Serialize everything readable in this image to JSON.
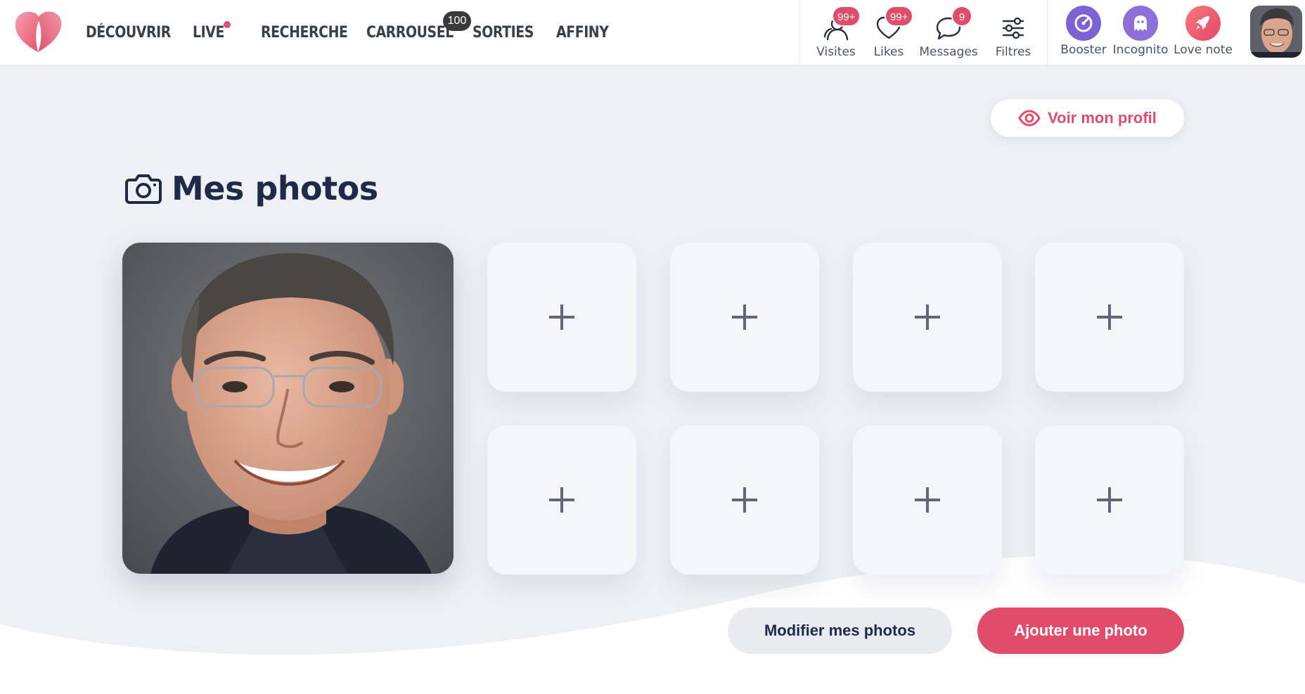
{
  "nav": {
    "items": [
      {
        "label": "DÉCOUVRIR"
      },
      {
        "label": "LIVE"
      },
      {
        "label": "RECHERCHE"
      },
      {
        "label": "CARROUSEL",
        "count": "100"
      },
      {
        "label": "SORTIES"
      },
      {
        "label": "AFFINY"
      }
    ]
  },
  "header_actions": [
    {
      "label": "Visites",
      "badge": "99+",
      "icon": "visitors-icon"
    },
    {
      "label": "Likes",
      "badge": "99+",
      "icon": "heart-icon"
    },
    {
      "label": "Messages",
      "badge": "9",
      "icon": "chat-bubble-icon"
    },
    {
      "label": "Filtres",
      "icon": "sliders-icon"
    }
  ],
  "premium": [
    {
      "label": "Booster",
      "icon": "gauge-icon",
      "color": "#7b63d6"
    },
    {
      "label": "Incognito",
      "icon": "ghost-icon",
      "color": "#8c6fd9"
    },
    {
      "label": "Love note",
      "icon": "rocket-icon",
      "color": "#ee5a6e"
    }
  ],
  "profile": {
    "view_label": "Voir mon profil"
  },
  "photos": {
    "title": "Mes photos",
    "empty_slots": 8,
    "edit_label": "Modifier mes photos",
    "add_label": "Ajouter une photo"
  },
  "colors": {
    "accent": "#e04d6b",
    "background": "#eef0f5",
    "title": "#1e2a48"
  }
}
